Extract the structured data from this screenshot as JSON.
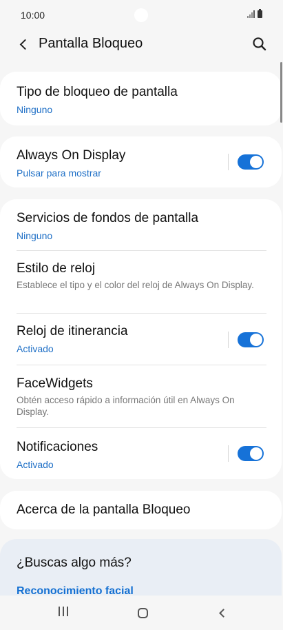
{
  "status_bar": {
    "time": "10:00"
  },
  "header": {
    "title": "Pantalla Bloqueo"
  },
  "lock_type": {
    "title": "Tipo de bloqueo de pantalla",
    "value": "Ninguno"
  },
  "aod": {
    "title": "Always On Display",
    "value": "Pulsar para mostrar",
    "enabled": true
  },
  "settings": {
    "wallpaper_services": {
      "title": "Servicios de fondos de pantalla",
      "value": "Ninguno"
    },
    "clock_style": {
      "title": "Estilo de reloj",
      "description": "Establece el tipo y el color del reloj de Always On Display."
    },
    "roaming_clock": {
      "title": "Reloj de itinerancia",
      "value": "Activado",
      "enabled": true
    },
    "facewidgets": {
      "title": "FaceWidgets",
      "description": "Obtén acceso rápido a información útil en Always On Display."
    },
    "notifications": {
      "title": "Notificaciones",
      "value": "Activado",
      "enabled": true
    }
  },
  "about": {
    "title": "Acerca de la pantalla Bloqueo"
  },
  "more": {
    "title": "¿Buscas algo más?",
    "link": "Reconocimiento facial"
  },
  "colors": {
    "accent": "#1672d8",
    "link": "#1e6fc6",
    "background": "#f6f6f6"
  },
  "icons": {
    "back": "chevron-left-icon",
    "search": "search-icon",
    "nav_recents": "recents-icon",
    "nav_home": "home-icon",
    "nav_back": "back-icon"
  }
}
